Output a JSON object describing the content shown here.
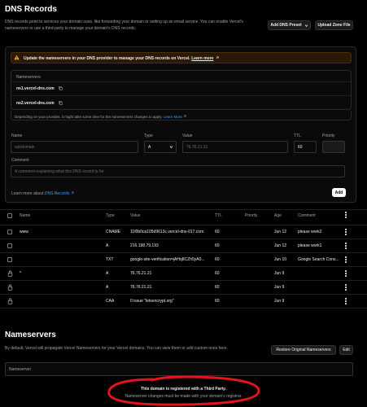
{
  "header": {
    "title": "DNS Records",
    "description_line1": "DNS records point to services your domain uses, like forwarding your domain or setting up an email service. You can enable Vercel's",
    "description_line2": "nameservers or use a third-party to manage your domain's DNS records.",
    "add_preset_label": "Add DNS Preset",
    "upload_zone_label": "Upload Zone File"
  },
  "warning": {
    "text": "Update the nameservers in your DNS provider to manage your DNS records on Vercel.",
    "link": "Learn more",
    "color": "#f5a623"
  },
  "nameserver_card": {
    "heading": "Nameservers",
    "ns1": "ns1.vercel-dns.com",
    "ns2": "ns2.vercel-dns.com",
    "note": "Depending on your provider, it might take some time for the nameservers changes to apply.",
    "note_link": "Learn More"
  },
  "form": {
    "name_label": "Name",
    "name_placeholder": "subdomain",
    "type_label": "Type",
    "type_value": "A",
    "value_label": "Value",
    "value_placeholder": "76.76.21.21",
    "ttl_label": "TTL",
    "ttl_value": "60",
    "priority_label": "Priority",
    "comment_label": "Comment",
    "comment_placeholder": "A comment explaining what this DNS record is for",
    "learn_prefix": "Learn more about",
    "learn_link": "DNS Records",
    "add_label": "Add"
  },
  "table": {
    "headers": [
      "Name",
      "Type",
      "Value",
      "TTL",
      "Priority",
      "Age",
      "Comment"
    ],
    "rows": [
      {
        "name": "www",
        "type": "CNAME",
        "value": "11f0b0ca105d9613c.vercel-dns-017.com.",
        "ttl": "60",
        "priority": "",
        "age": "Jun 12",
        "comment": "please work2",
        "locked": false
      },
      {
        "name": "",
        "type": "A",
        "value": "216.198.79.193",
        "ttl": "60",
        "priority": "",
        "age": "Jun 12",
        "comment": "please work1",
        "locked": false
      },
      {
        "name": "",
        "type": "TXT",
        "value": "google-site-verification=jAHq8CZh5yA0...",
        "ttl": "60",
        "priority": "",
        "age": "Jun 10",
        "comment": "Google Search Cons...",
        "locked": false
      },
      {
        "name": "*",
        "type": "A",
        "value": "76.76.21.21",
        "ttl": "60",
        "priority": "",
        "age": "Jun 9",
        "comment": "",
        "locked": true
      },
      {
        "name": "",
        "type": "A",
        "value": "76.76.21.21",
        "ttl": "60",
        "priority": "",
        "age": "Jun 9",
        "comment": "",
        "locked": true
      },
      {
        "name": "",
        "type": "CAA",
        "value": "0 issue \"letsencrypt.org\"",
        "ttl": "60",
        "priority": "",
        "age": "Jun 9",
        "comment": "",
        "locked": true
      }
    ]
  },
  "nameservers_section": {
    "title": "Nameservers",
    "description": "By default, Vercel will propagate Vercel Nameservers for your Vercel domains. You can view them or add custom ones here.",
    "restore_label": "Restore Original Nameservers",
    "edit_label": "Edit",
    "input_placeholder": "Nameserver",
    "third_party_title": "This domain is registered with a Third Party.",
    "third_party_note": "Nameserver changes must be made with your domain's registrar.",
    "annotation_color": "#e5141b"
  }
}
